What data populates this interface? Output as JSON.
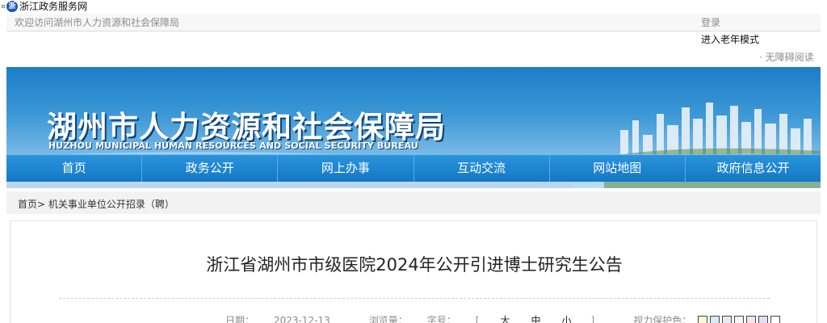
{
  "portal": {
    "logo_icon": "zhejiang-government-logo-icon",
    "name": "浙江政务服务网"
  },
  "top_strip": {
    "welcome": "欢迎访问湖州市人力资源和社会保障局",
    "login": "登录",
    "elder_mode": "进入老年模式",
    "accessibility": "· 无障碍阅读"
  },
  "banner": {
    "title": "湖州市人力资源和社会保障局",
    "subtitle": "HUZHOU MUNICIPAL HUMAN RESOURCES AND SOCIAL SECURITY BUREAU"
  },
  "nav": {
    "items": [
      {
        "label": "首页"
      },
      {
        "label": "政务公开"
      },
      {
        "label": "网上办事"
      },
      {
        "label": "互动交流"
      },
      {
        "label": "网站地图"
      },
      {
        "label": "政府信息公开"
      }
    ]
  },
  "breadcrumb": {
    "home": "首页",
    "separator": ">",
    "section": "机关事业单位公开招录（聘）"
  },
  "article": {
    "title": "浙江省湖州市市级医院2024年公开引进博士研究生公告",
    "date_label": "日期：",
    "date": "2023-12-13",
    "views_label": "浏览量：",
    "font_size_label": "字号：",
    "font_size_open": "[",
    "font_large": "大",
    "font_medium": "中",
    "font_small": "小",
    "font_size_close": "]",
    "eye_protect_label": "视力保护色："
  },
  "colors": {
    "nav_bg": "#1a86d0",
    "banner_sky": "#3d98d6",
    "swatches": [
      "#fbf6d8",
      "#d6ebf8",
      "#e8e8f2",
      "#f5f5f5",
      "#f9e3ea",
      "#e7dcf5",
      "#ffffff"
    ]
  }
}
